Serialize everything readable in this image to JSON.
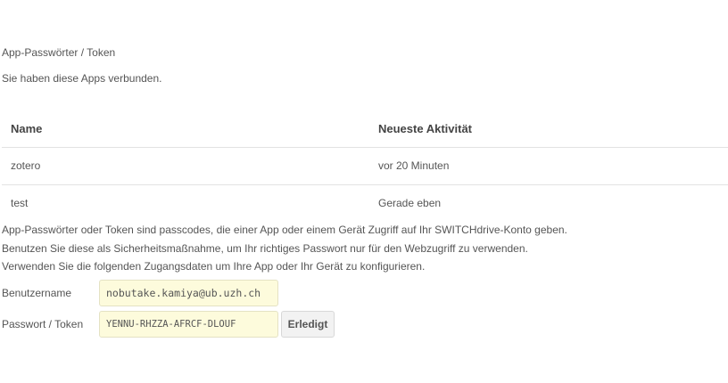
{
  "section": {
    "title": "App-Passwörter / Token",
    "description": "Sie haben diese Apps verbunden."
  },
  "table": {
    "headers": {
      "name": "Name",
      "activity": "Neueste Aktivität"
    },
    "rows": [
      {
        "name": "zotero",
        "activity": "vor 20 Minuten"
      },
      {
        "name": "test",
        "activity": "Gerade eben"
      }
    ]
  },
  "info": [
    "App-Passwörter oder Token sind passcodes, die einer App oder einem Gerät Zugriff auf Ihr SWITCHdrive-Konto geben.",
    "Benutzen Sie diese als Sicherheitsmaßnahme, um Ihr richtiges Passwort nur für den Webzugriff zu verwenden.",
    "Verwenden Sie die folgenden Zugangsdaten um Ihre App oder Ihr Gerät zu konfigurieren."
  ],
  "credentials": {
    "username_label": "Benutzername",
    "username_value": "nobutake.kamiya@ub.uzh.ch",
    "password_label": "Passwort / Token",
    "password_value": "YENNU-RHZZA-AFRCF-DLOUF",
    "done_label": "Erledigt"
  }
}
